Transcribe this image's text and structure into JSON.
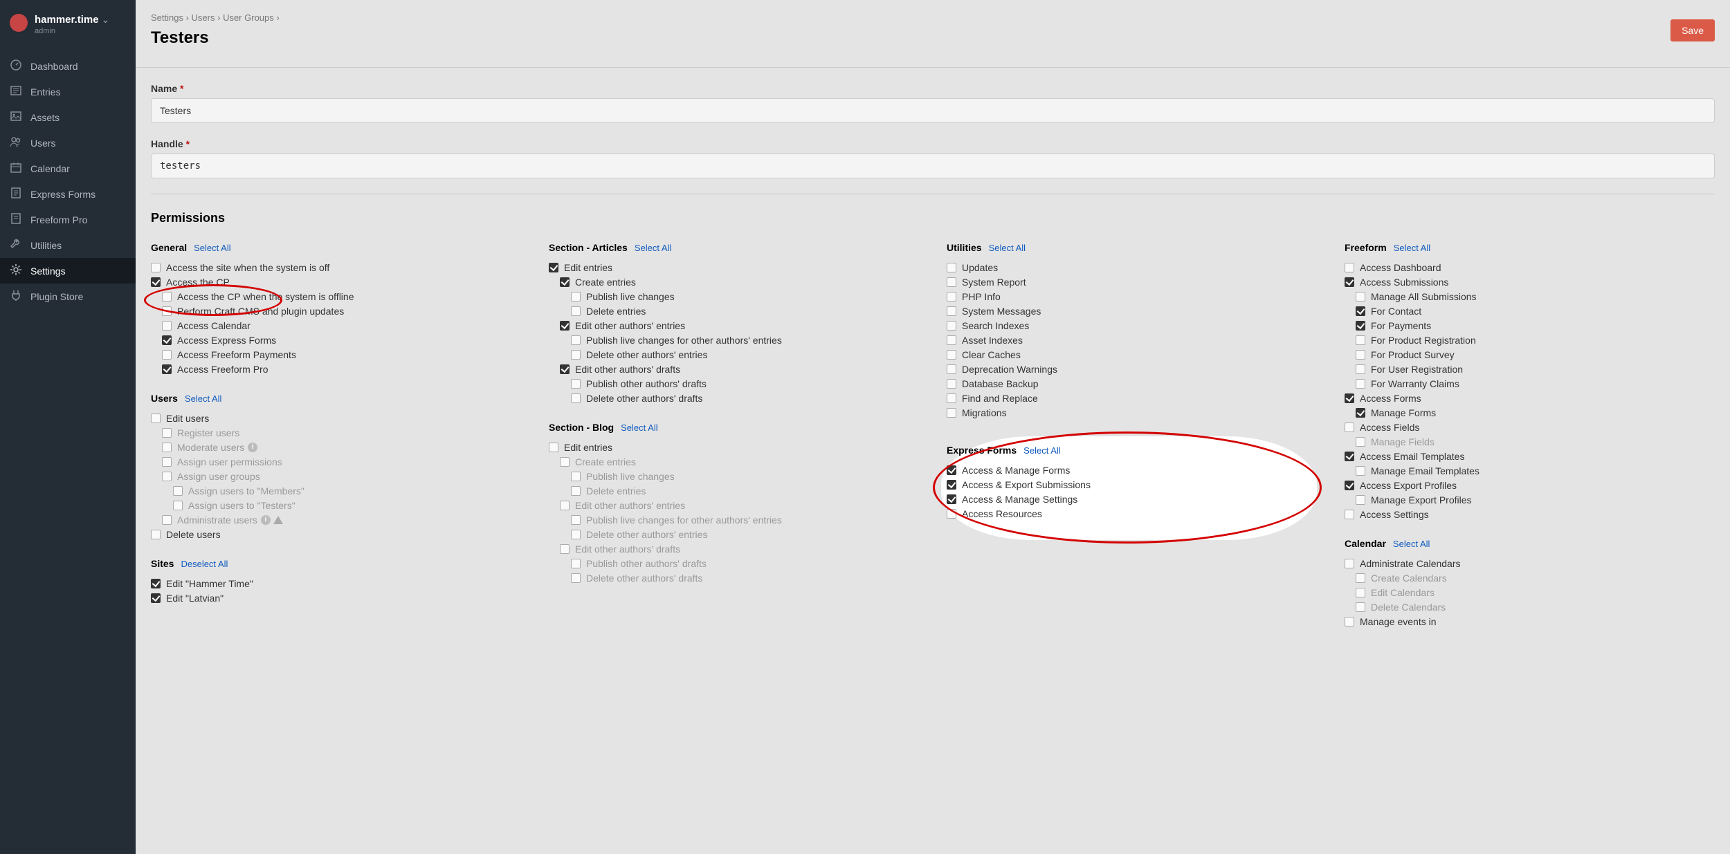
{
  "sidebar": {
    "site_name": "hammer.time",
    "role": "admin",
    "items": [
      {
        "id": "dashboard",
        "label": "Dashboard",
        "icon": "gauge"
      },
      {
        "id": "entries",
        "label": "Entries",
        "icon": "news"
      },
      {
        "id": "assets",
        "label": "Assets",
        "icon": "image"
      },
      {
        "id": "users",
        "label": "Users",
        "icon": "users"
      },
      {
        "id": "calendar",
        "label": "Calendar",
        "icon": "calendar"
      },
      {
        "id": "express-forms",
        "label": "Express Forms",
        "icon": "form"
      },
      {
        "id": "freeform-pro",
        "label": "Freeform Pro",
        "icon": "form2"
      },
      {
        "id": "utilities",
        "label": "Utilities",
        "icon": "wrench"
      },
      {
        "id": "settings",
        "label": "Settings",
        "icon": "gear",
        "active": true
      },
      {
        "id": "plugin-store",
        "label": "Plugin Store",
        "icon": "plug"
      }
    ]
  },
  "header": {
    "crumbs": [
      "Settings",
      "Users",
      "User Groups"
    ],
    "title": "Testers",
    "save_label": "Save"
  },
  "fields": {
    "name_label": "Name",
    "name_value": "Testers",
    "handle_label": "Handle",
    "handle_value": "testers"
  },
  "permissions_title": "Permissions",
  "select_all_label": "Select All",
  "deselect_all_label": "Deselect All",
  "columns": [
    {
      "groups": [
        {
          "title": "General",
          "items": [
            {
              "label": "Access the site when the system is off",
              "depth": 0,
              "checked": false
            },
            {
              "label": "Access the CP",
              "depth": 0,
              "checked": true
            },
            {
              "label": "Access the CP when the system is offline",
              "depth": 1,
              "checked": false
            },
            {
              "label": "Perform Craft CMS and plugin updates",
              "depth": 1,
              "checked": false
            },
            {
              "label": "Access Calendar",
              "depth": 1,
              "checked": false
            },
            {
              "label": "Access Express Forms",
              "depth": 1,
              "checked": true,
              "highlight": true
            },
            {
              "label": "Access Freeform Payments",
              "depth": 1,
              "checked": false
            },
            {
              "label": "Access Freeform Pro",
              "depth": 1,
              "checked": true
            }
          ]
        },
        {
          "title": "Users",
          "items": [
            {
              "label": "Edit users",
              "depth": 0,
              "checked": false
            },
            {
              "label": "Register users",
              "depth": 1,
              "checked": false,
              "disabled": true
            },
            {
              "label": "Moderate users",
              "depth": 1,
              "checked": false,
              "disabled": true,
              "info": true
            },
            {
              "label": "Assign user permissions",
              "depth": 1,
              "checked": false,
              "disabled": true
            },
            {
              "label": "Assign user groups",
              "depth": 1,
              "checked": false,
              "disabled": true
            },
            {
              "label": "Assign users to \"Members\"",
              "depth": 2,
              "checked": false,
              "disabled": true
            },
            {
              "label": "Assign users to \"Testers\"",
              "depth": 2,
              "checked": false,
              "disabled": true
            },
            {
              "label": "Administrate users",
              "depth": 1,
              "checked": false,
              "disabled": true,
              "info": true,
              "warn": true
            },
            {
              "label": "Delete users",
              "depth": 0,
              "checked": false
            }
          ]
        },
        {
          "title": "Sites",
          "deselect": true,
          "items": [
            {
              "label": "Edit \"Hammer Time\"",
              "depth": 0,
              "checked": true
            },
            {
              "label": "Edit \"Latvian\"",
              "depth": 0,
              "checked": true
            }
          ]
        }
      ]
    },
    {
      "groups": [
        {
          "title": "Section - Articles",
          "items": [
            {
              "label": "Edit entries",
              "depth": 0,
              "checked": true
            },
            {
              "label": "Create entries",
              "depth": 1,
              "checked": true
            },
            {
              "label": "Publish live changes",
              "depth": 2,
              "checked": false
            },
            {
              "label": "Delete entries",
              "depth": 2,
              "checked": false
            },
            {
              "label": "Edit other authors' entries",
              "depth": 1,
              "checked": true
            },
            {
              "label": "Publish live changes for other authors' entries",
              "depth": 2,
              "checked": false
            },
            {
              "label": "Delete other authors' entries",
              "depth": 2,
              "checked": false
            },
            {
              "label": "Edit other authors' drafts",
              "depth": 1,
              "checked": true
            },
            {
              "label": "Publish other authors' drafts",
              "depth": 2,
              "checked": false
            },
            {
              "label": "Delete other authors' drafts",
              "depth": 2,
              "checked": false
            }
          ]
        },
        {
          "title": "Section - Blog",
          "items": [
            {
              "label": "Edit entries",
              "depth": 0,
              "checked": false
            },
            {
              "label": "Create entries",
              "depth": 1,
              "checked": false,
              "disabled": true
            },
            {
              "label": "Publish live changes",
              "depth": 2,
              "checked": false,
              "disabled": true
            },
            {
              "label": "Delete entries",
              "depth": 2,
              "checked": false,
              "disabled": true
            },
            {
              "label": "Edit other authors' entries",
              "depth": 1,
              "checked": false,
              "disabled": true
            },
            {
              "label": "Publish live changes for other authors' entries",
              "depth": 2,
              "checked": false,
              "disabled": true
            },
            {
              "label": "Delete other authors' entries",
              "depth": 2,
              "checked": false,
              "disabled": true
            },
            {
              "label": "Edit other authors' drafts",
              "depth": 1,
              "checked": false,
              "disabled": true
            },
            {
              "label": "Publish other authors' drafts",
              "depth": 2,
              "checked": false,
              "disabled": true
            },
            {
              "label": "Delete other authors' drafts",
              "depth": 2,
              "checked": false,
              "disabled": true
            }
          ]
        }
      ]
    },
    {
      "groups": [
        {
          "title": "Utilities",
          "items": [
            {
              "label": "Updates",
              "depth": 0,
              "checked": false
            },
            {
              "label": "System Report",
              "depth": 0,
              "checked": false
            },
            {
              "label": "PHP Info",
              "depth": 0,
              "checked": false
            },
            {
              "label": "System Messages",
              "depth": 0,
              "checked": false
            },
            {
              "label": "Search Indexes",
              "depth": 0,
              "checked": false
            },
            {
              "label": "Asset Indexes",
              "depth": 0,
              "checked": false
            },
            {
              "label": "Clear Caches",
              "depth": 0,
              "checked": false
            },
            {
              "label": "Deprecation Warnings",
              "depth": 0,
              "checked": false
            },
            {
              "label": "Database Backup",
              "depth": 0,
              "checked": false
            },
            {
              "label": "Find and Replace",
              "depth": 0,
              "checked": false
            },
            {
              "label": "Migrations",
              "depth": 0,
              "checked": false
            }
          ]
        },
        {
          "title": "Express Forms",
          "highlight_group": true,
          "items": [
            {
              "label": "Access & Manage Forms",
              "depth": 0,
              "checked": true
            },
            {
              "label": "Access & Export Submissions",
              "depth": 0,
              "checked": true
            },
            {
              "label": "Access & Manage Settings",
              "depth": 0,
              "checked": true
            },
            {
              "label": "Access Resources",
              "depth": 0,
              "checked": false
            }
          ]
        }
      ]
    },
    {
      "groups": [
        {
          "title": "Freeform",
          "items": [
            {
              "label": "Access Dashboard",
              "depth": 0,
              "checked": false
            },
            {
              "label": "Access Submissions",
              "depth": 0,
              "checked": true
            },
            {
              "label": "Manage All Submissions",
              "depth": 1,
              "checked": false
            },
            {
              "label": "For Contact",
              "depth": 1,
              "checked": true
            },
            {
              "label": "For Payments",
              "depth": 1,
              "checked": true
            },
            {
              "label": "For Product Registration",
              "depth": 1,
              "checked": false
            },
            {
              "label": "For Product Survey",
              "depth": 1,
              "checked": false
            },
            {
              "label": "For User Registration",
              "depth": 1,
              "checked": false
            },
            {
              "label": "For Warranty Claims",
              "depth": 1,
              "checked": false
            },
            {
              "label": "Access Forms",
              "depth": 0,
              "checked": true
            },
            {
              "label": "Manage Forms",
              "depth": 1,
              "checked": true
            },
            {
              "label": "Access Fields",
              "depth": 0,
              "checked": false
            },
            {
              "label": "Manage Fields",
              "depth": 1,
              "checked": false,
              "disabled": true
            },
            {
              "label": "Access Email Templates",
              "depth": 0,
              "checked": true
            },
            {
              "label": "Manage Email Templates",
              "depth": 1,
              "checked": false
            },
            {
              "label": "Access Export Profiles",
              "depth": 0,
              "checked": true
            },
            {
              "label": "Manage Export Profiles",
              "depth": 1,
              "checked": false
            },
            {
              "label": "Access Settings",
              "depth": 0,
              "checked": false
            }
          ]
        },
        {
          "title": "Calendar",
          "items": [
            {
              "label": "Administrate Calendars",
              "depth": 0,
              "checked": false
            },
            {
              "label": "Create Calendars",
              "depth": 1,
              "checked": false,
              "disabled": true
            },
            {
              "label": "Edit Calendars",
              "depth": 1,
              "checked": false,
              "disabled": true
            },
            {
              "label": "Delete Calendars",
              "depth": 1,
              "checked": false,
              "disabled": true
            },
            {
              "label": "Manage events in",
              "depth": 0,
              "checked": false
            }
          ]
        }
      ]
    }
  ]
}
